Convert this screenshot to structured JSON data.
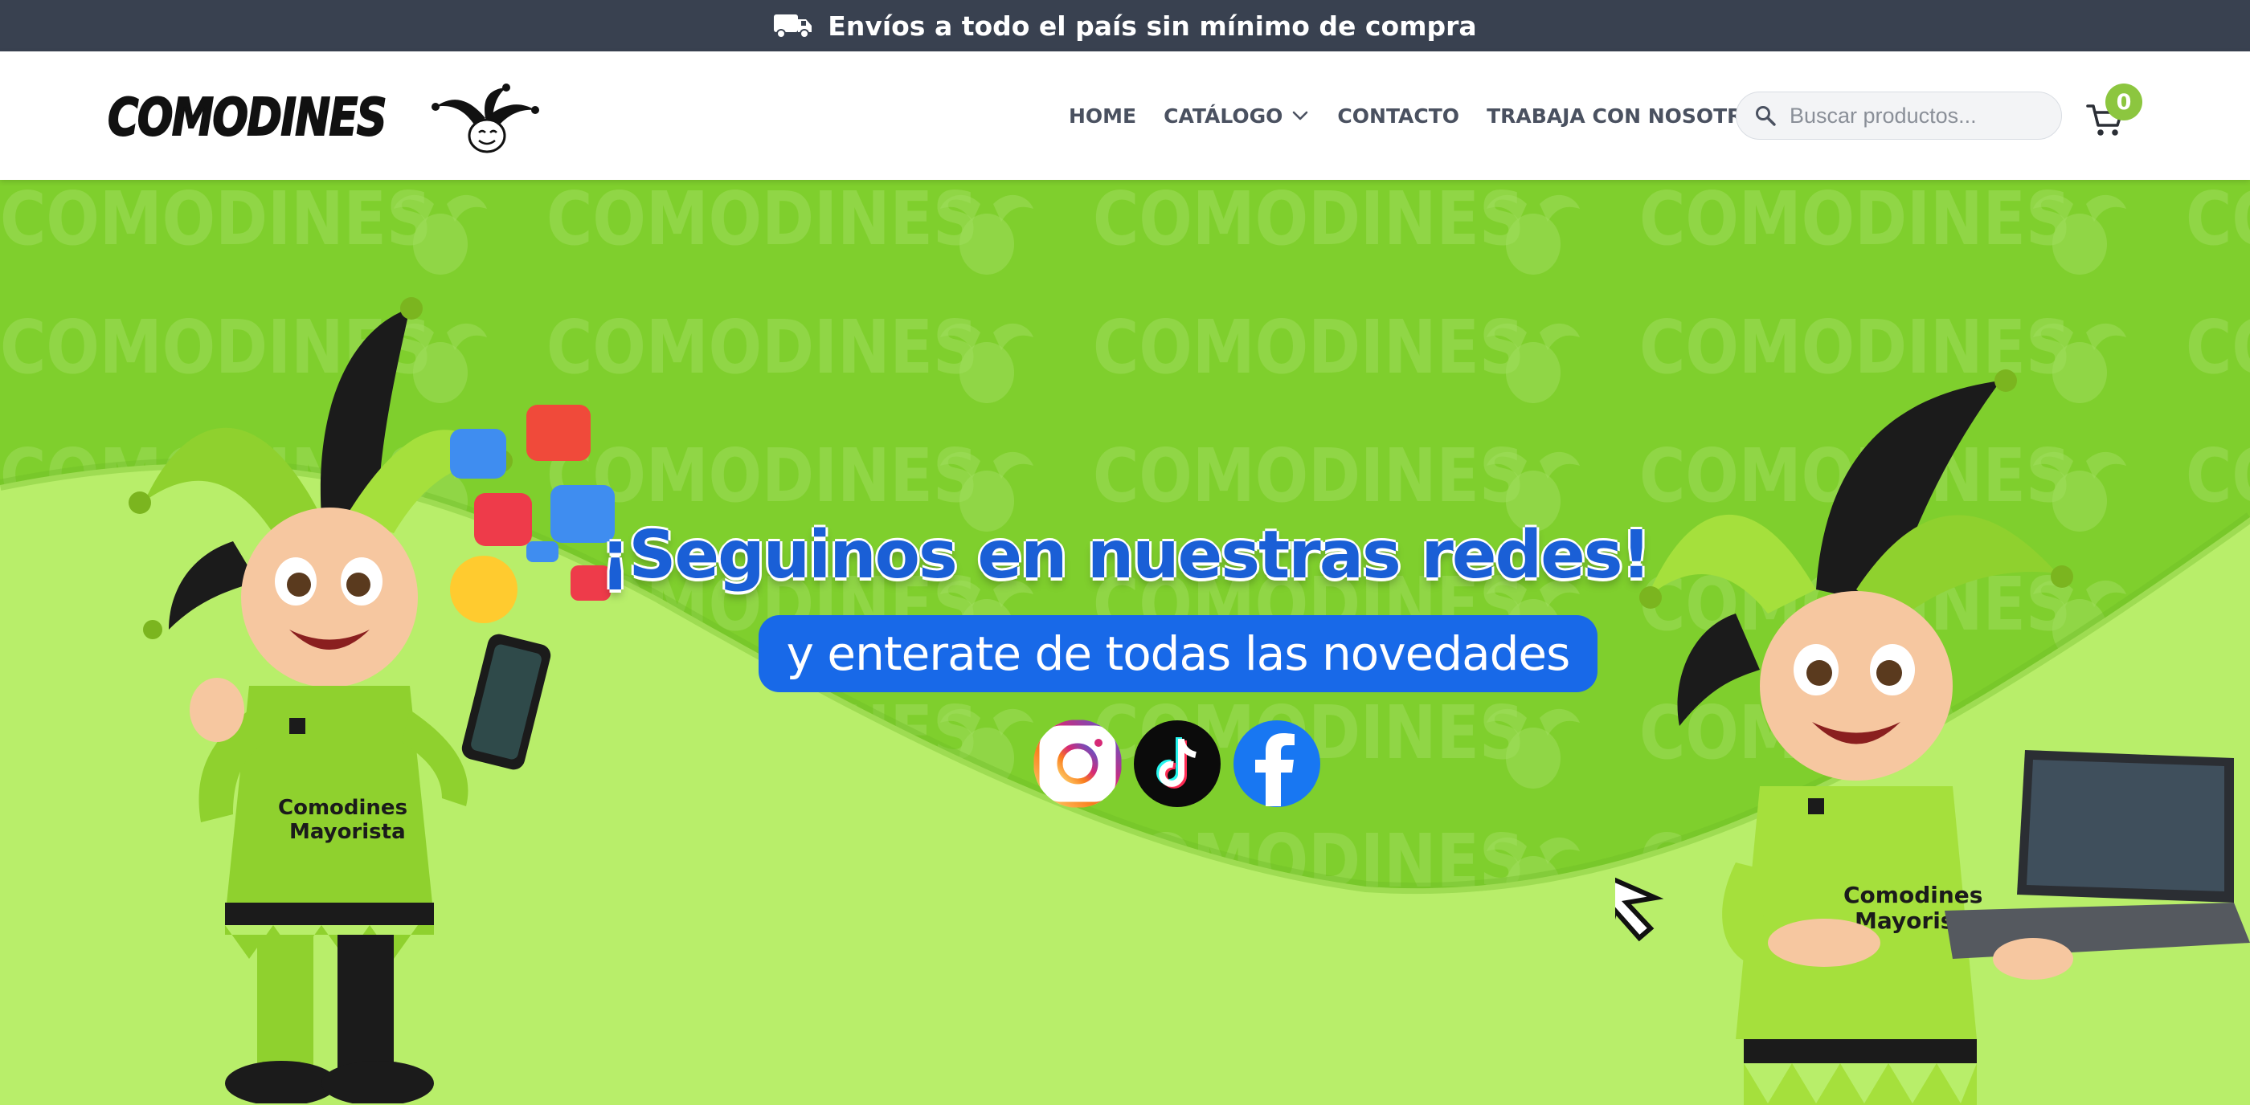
{
  "announcement": {
    "text": "Envíos a todo el país sin mínimo de compra",
    "icon": "truck-icon"
  },
  "header": {
    "logo_text": "COMODINES",
    "nav": [
      {
        "label": "HOME"
      },
      {
        "label": "CATÁLOGO"
      },
      {
        "label": "CONTACTO"
      },
      {
        "label": "TRABAJA CON NOSOTROS"
      }
    ],
    "search": {
      "placeholder": "Buscar productos..."
    },
    "cart": {
      "count": "0"
    }
  },
  "hero": {
    "headline": "¡Seguinos en nuestras redes!",
    "subheadline": "y enterate de todas las novedades",
    "background_word": "COMODINES",
    "mascot_left_shirt": [
      "Comodines",
      "Mayorista"
    ],
    "mascot_right_shirt": [
      "Comodines",
      "Mayorista"
    ],
    "socials": [
      "instagram-icon",
      "tiktok-icon",
      "facebook-icon"
    ]
  },
  "colors": {
    "topbar": "#394150",
    "accent_green": "#8cc63f",
    "hero_green": "#8cd63a",
    "headline_blue": "#1a5fd6",
    "pill_blue": "#1869e8"
  }
}
